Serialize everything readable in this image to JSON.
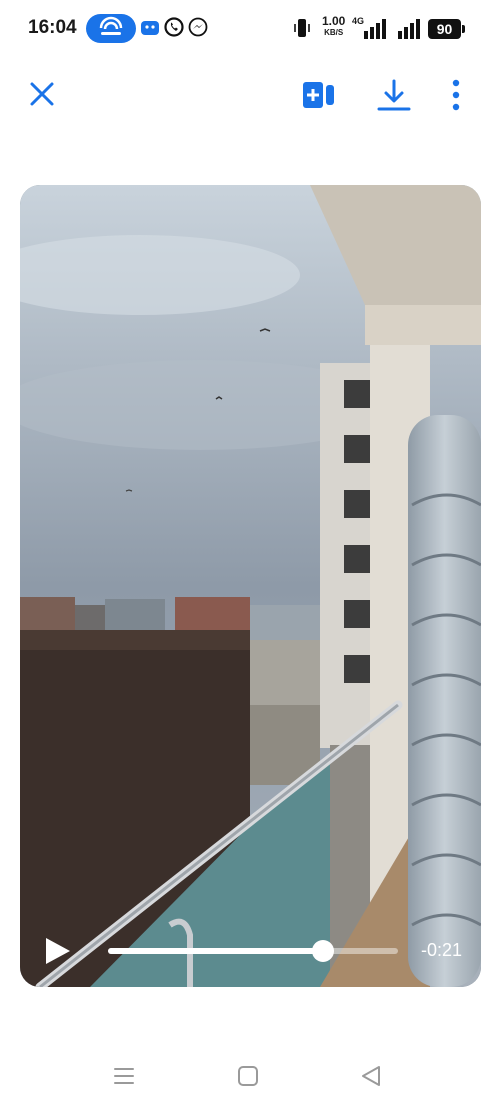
{
  "status_bar": {
    "time": "16:04",
    "net_speed_value": "1.00",
    "net_speed_unit": "KB/S",
    "network_type": "4G",
    "battery_level": "90",
    "accent_color": "#1a73e8"
  },
  "toolbar": {
    "icons": [
      "close-icon",
      "add-to-story-icon",
      "download-icon",
      "more-vert-icon"
    ],
    "icon_color": "#1a73e8"
  },
  "video": {
    "remaining_time": "-0:21",
    "progress": 0.74,
    "state": "paused"
  },
  "nav_bar": {
    "icons": [
      "recents-icon",
      "home-icon",
      "back-icon"
    ]
  }
}
